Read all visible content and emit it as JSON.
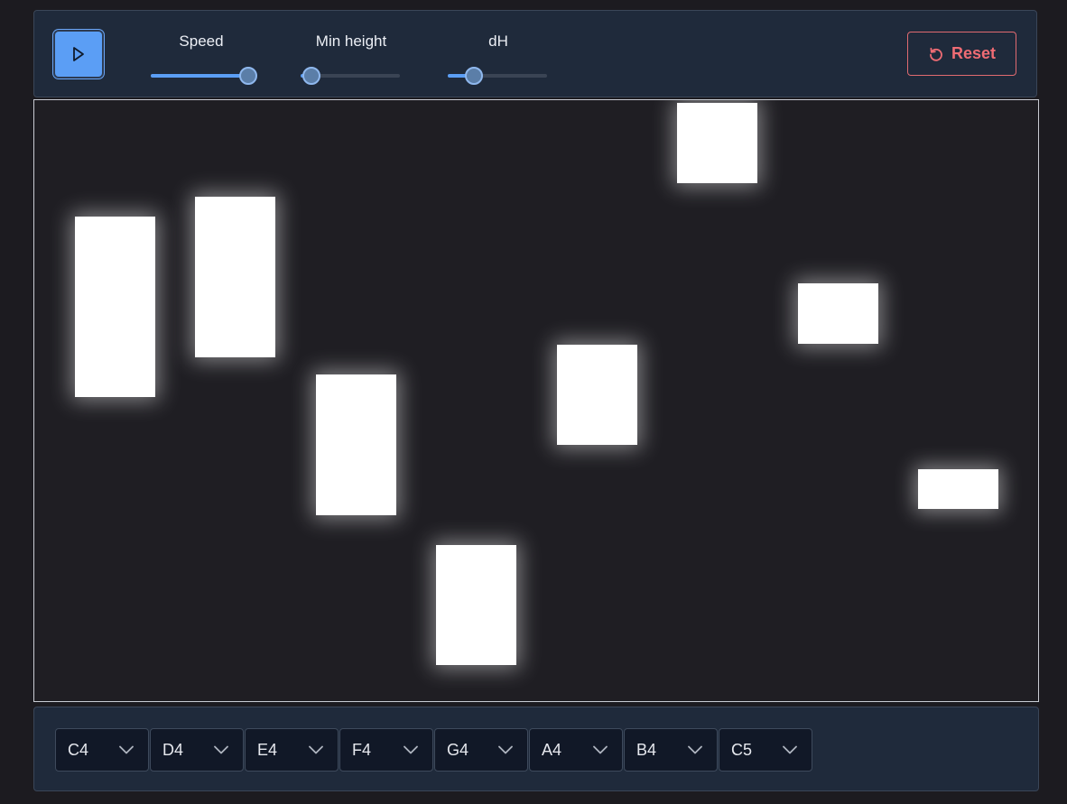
{
  "toolbar": {
    "play_icon": "play-icon",
    "sliders": [
      {
        "label": "Speed",
        "value": 0.97
      },
      {
        "label": "Min height",
        "value": 0.1
      },
      {
        "label": "dH",
        "value": 0.25
      }
    ],
    "reset": {
      "label": "Reset",
      "icon": "reset-icon",
      "color": "#ef6c74"
    }
  },
  "notes": [
    "C4",
    "D4",
    "E4",
    "F4",
    "G4",
    "A4",
    "B4",
    "C5"
  ],
  "colors": {
    "accent": "#5b9ef5",
    "danger": "#ef6c74"
  }
}
